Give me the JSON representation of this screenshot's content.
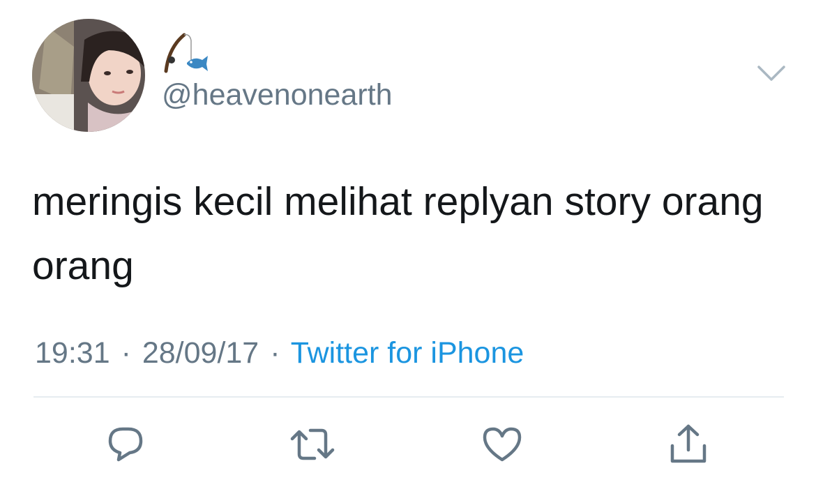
{
  "user": {
    "display_name": "🎣🐟",
    "handle": "@heavenonearth"
  },
  "tweet": {
    "text": "meringis kecil melihat replyan story orang orang",
    "time": "19:31",
    "date": "28/09/17",
    "separator": "·",
    "source": "Twitter for iPhone"
  },
  "icons": {
    "menu": "chevron-down-icon",
    "reply": "reply-icon",
    "retweet": "retweet-icon",
    "like": "heart-icon",
    "share": "share-icon"
  },
  "colors": {
    "text": "#14171a",
    "secondary": "#657786",
    "link": "#1b95e0",
    "divider": "#e6ecf0"
  }
}
